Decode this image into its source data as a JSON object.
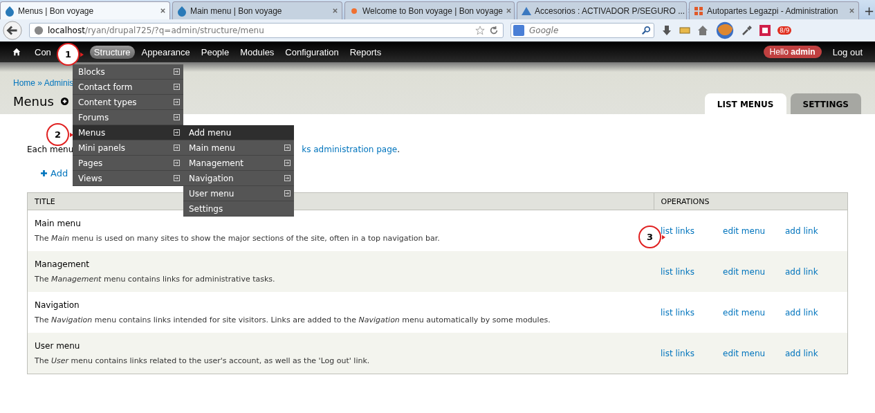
{
  "browser": {
    "tabs": [
      {
        "title": "Menus | Bon voyage",
        "selected": true
      },
      {
        "title": "Main menu | Bon voyage",
        "selected": false
      },
      {
        "title": "Welcome to Bon voyage | Bon voyage",
        "selected": false
      },
      {
        "title": "Accesorios : ACTIVADOR P/SEGURO ...",
        "selected": false
      },
      {
        "title": "Autopartes Legazpi - Administration",
        "selected": false
      }
    ],
    "new_tab": "+",
    "address": {
      "host": "localhost",
      "path": "/ryan/drupal725/?q=admin/structure/menu"
    },
    "search": {
      "placeholder": "Google"
    },
    "badge": "8/9"
  },
  "toolbar": {
    "items": [
      {
        "label": "Con",
        "selected": false
      },
      {
        "label": "Structure",
        "selected": true
      },
      {
        "label": "Appearance",
        "selected": false
      },
      {
        "label": "People",
        "selected": false
      },
      {
        "label": "Modules",
        "selected": false
      },
      {
        "label": "Configuration",
        "selected": false
      },
      {
        "label": "Reports",
        "selected": false
      }
    ],
    "greeting": "Hello **admin**",
    "logout": "Log out"
  },
  "dropdown": {
    "items": [
      {
        "label": "Blocks",
        "selected": false,
        "has_submenu": true
      },
      {
        "label": "Contact form",
        "selected": false,
        "has_submenu": true
      },
      {
        "label": "Content types",
        "selected": false,
        "has_submenu": true
      },
      {
        "label": "Forums",
        "selected": false,
        "has_submenu": true
      },
      {
        "label": "Menus",
        "selected": true,
        "has_submenu": true
      },
      {
        "label": "Mini panels",
        "selected": false,
        "has_submenu": true
      },
      {
        "label": "Pages",
        "selected": false,
        "has_submenu": true
      },
      {
        "label": "Views",
        "selected": false,
        "has_submenu": true
      }
    ],
    "submenu": [
      {
        "label": "Add menu",
        "selected": true,
        "has_submenu": false
      },
      {
        "label": "Main menu",
        "selected": false,
        "has_submenu": true
      },
      {
        "label": "Management",
        "selected": false,
        "has_submenu": true
      },
      {
        "label": "Navigation",
        "selected": false,
        "has_submenu": true
      },
      {
        "label": "User menu",
        "selected": false,
        "has_submenu": true
      },
      {
        "label": "Settings",
        "selected": false,
        "has_submenu": false
      }
    ]
  },
  "header": {
    "breadcrumb": "Home » Adminis",
    "title": "Menus",
    "tabs": [
      {
        "label": "LIST MENUS",
        "selected": true
      },
      {
        "label": "SETTINGS",
        "selected": false
      }
    ]
  },
  "callouts": [
    "1",
    "2",
    "3"
  ],
  "intro": {
    "text": "Each menu",
    "link": "ks administration page",
    "end": "."
  },
  "add_link": "Add",
  "table": {
    "columns": [
      "TITLE",
      "OPERATIONS"
    ],
    "rows": [
      {
        "title": "Main menu",
        "description": "The *Main* menu is used on many sites to show the major sections of the site, often in a top navigation bar.",
        "operations": [
          "list links",
          "edit menu",
          "add link"
        ]
      },
      {
        "title": "Management",
        "description": "The *Management* menu contains links for administrative tasks.",
        "operations": [
          "list links",
          "edit menu",
          "add link"
        ]
      },
      {
        "title": "Navigation",
        "description": "The *Navigation* menu contains links intended for site visitors. Links are added to the *Navigation* menu automatically by some modules.",
        "operations": [
          "list links",
          "edit menu",
          "add link"
        ]
      },
      {
        "title": "User menu",
        "description": "The *User* menu contains links related to the user's account, as well as the 'Log out' link.",
        "operations": [
          "list links",
          "edit menu",
          "add link"
        ]
      }
    ]
  }
}
